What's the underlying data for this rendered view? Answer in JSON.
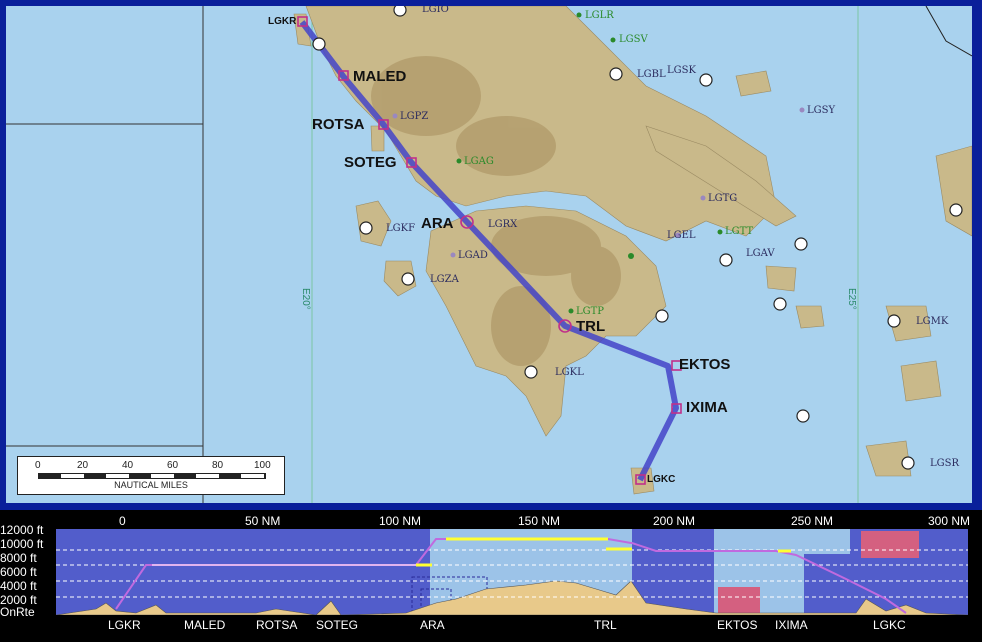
{
  "map": {
    "waypoints": [
      {
        "id": "LGKR",
        "label": "LGKR"
      },
      {
        "id": "MALED",
        "label": "MALED"
      },
      {
        "id": "ROTSA",
        "label": "ROTSA"
      },
      {
        "id": "SOTEG",
        "label": "SOTEG"
      },
      {
        "id": "ARA",
        "label": "ARA"
      },
      {
        "id": "TRL",
        "label": "TRL"
      },
      {
        "id": "EKTOS",
        "label": "EKTOS"
      },
      {
        "id": "IXIMA",
        "label": "IXIMA"
      },
      {
        "id": "LGKC",
        "label": "LGKC"
      }
    ],
    "airports": {
      "lgio": "LGIO",
      "lglr": "LGLR",
      "lgsv": "LGSV",
      "lgbl": "LGBL",
      "lgsk": "LGSK",
      "lgsy": "LGSY",
      "lgpz": "LGPZ",
      "lgag": "LGAG",
      "lgtg": "LGTG",
      "lgkf": "LGKF",
      "lgrx": "LGRX",
      "lgtt": "LGTT",
      "lgel": "LGEL",
      "lgav": "LGAV",
      "lgad": "LGAD",
      "lgza": "LGZA",
      "lgtp": "LGTP",
      "lgmk": "LGMK",
      "lgkl": "LGKL",
      "lgsr": "LGSR"
    },
    "longitudes": {
      "e20": "E20°",
      "e25": "E25°"
    },
    "scale": {
      "ticks": [
        "0",
        "20",
        "40",
        "60",
        "80",
        "100"
      ],
      "title": "NAUTICAL MILES"
    }
  },
  "profile": {
    "distance_labels": [
      "0",
      "50 NM",
      "100 NM",
      "150 NM",
      "200 NM",
      "250 NM",
      "300 NM"
    ],
    "altitude_labels": [
      "12000 ft",
      "10000 ft",
      "8000 ft",
      "6000 ft",
      "4000 ft",
      "2000 ft",
      "OnRte"
    ],
    "waypoint_names": [
      "LGKR",
      "MALED",
      "ROTSA",
      "SOTEG",
      "ARA",
      "TRL",
      "EKTOS",
      "IXIMA",
      "LGKC"
    ]
  },
  "colors": {
    "sea": "#a9d2ee",
    "route": "#4444c8",
    "frame": "#0a1f9a",
    "waypoint": "#c0308a"
  }
}
